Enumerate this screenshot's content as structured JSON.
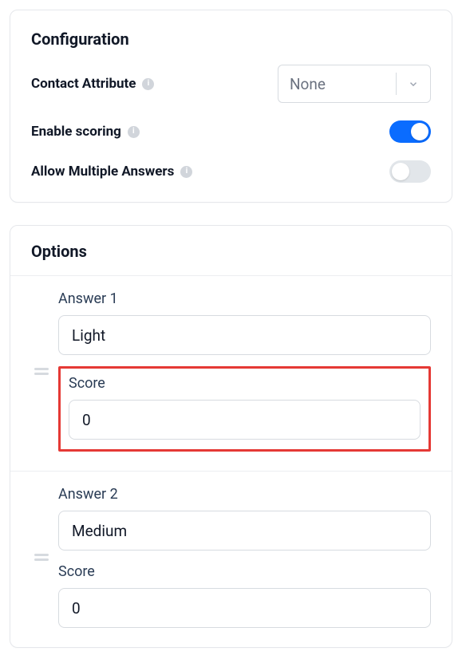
{
  "configuration": {
    "title": "Configuration",
    "contact_attribute": {
      "label": "Contact Attribute",
      "value": "None"
    },
    "enable_scoring": {
      "label": "Enable scoring",
      "enabled": true
    },
    "allow_multiple": {
      "label": "Allow Multiple Answers",
      "enabled": false
    }
  },
  "options": {
    "title": "Options",
    "score_label": "Score",
    "answers": [
      {
        "label": "Answer 1",
        "value": "Light",
        "score": "0",
        "highlighted": true
      },
      {
        "label": "Answer 2",
        "value": "Medium",
        "score": "0",
        "highlighted": false
      }
    ]
  }
}
